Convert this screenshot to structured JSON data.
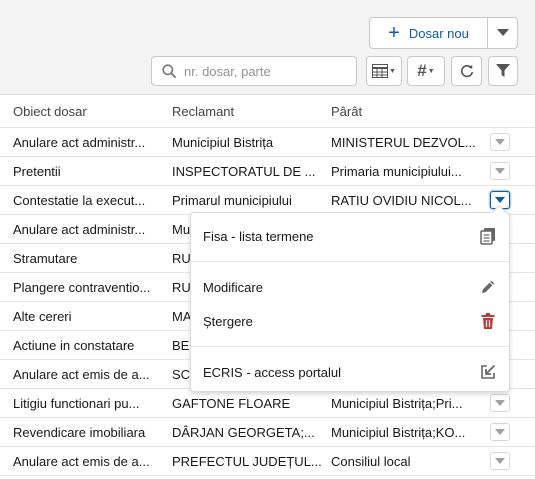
{
  "toolbar": {
    "new_button_label": "Dosar nou",
    "search_placeholder": "nr. dosar, parte",
    "search_value": ""
  },
  "table": {
    "headers": [
      "Obiect dosar",
      "Reclamant",
      "Pârât"
    ],
    "rows": [
      [
        "Anulare act administr...",
        "Municipiul Bistrița",
        "MINISTERUL DEZVOL..."
      ],
      [
        "Pretentii",
        "INSPECTORATUL DE ...",
        "Primaria municipiului..."
      ],
      [
        "Contestatie la execut...",
        "Primarul municipiului",
        "RATIU OVIDIU NICOL..."
      ],
      [
        "Anulare act administr...",
        "Mu",
        ""
      ],
      [
        "Stramutare",
        "RU",
        ""
      ],
      [
        "Plangere contraventio...",
        "RU",
        ""
      ],
      [
        "Alte cereri",
        "MA",
        ""
      ],
      [
        "Actiune in constatare",
        "BEL",
        ""
      ],
      [
        "Anulare act emis de a...",
        "SC",
        ""
      ],
      [
        "Litigiu functionari pu...",
        "GAFTONE FLOARE",
        "Municipiul Bistrița;Pri..."
      ],
      [
        "Revendicare imobiliara",
        "DÂRJAN GEORGETA;...",
        "Municipiul Bistrița;KO..."
      ],
      [
        "Anulare act emis de a...",
        "PREFECTUL JUDEȚUL...",
        "Consiliul local"
      ]
    ]
  },
  "menu": {
    "items": [
      "Fisa - lista termene",
      "Modificare",
      "Ștergere",
      "ECRIS - access portalul"
    ],
    "icons": [
      "copy-icon",
      "edit-icon",
      "delete-icon",
      "external-link-icon"
    ]
  },
  "colors": {
    "brand": "#0b5cab",
    "delete": "#c23934",
    "header_bg": "#f3f3f3"
  }
}
